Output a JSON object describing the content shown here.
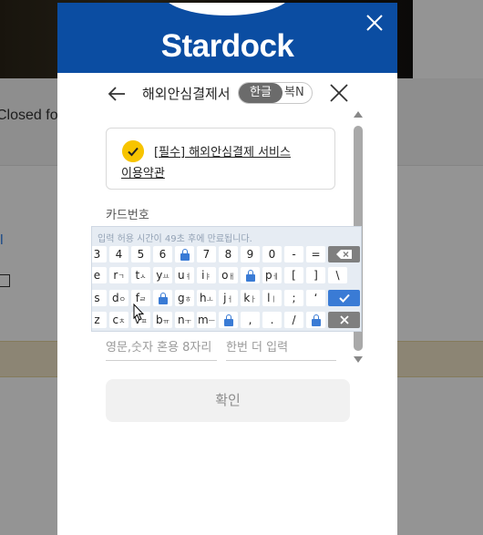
{
  "background": {
    "closed_text": "Closed fo",
    "link_text": "ll"
  },
  "modal": {
    "brand": "Stardock",
    "close_icon": "close-icon"
  },
  "panel": {
    "title": "해외안심결제서",
    "lang_active": "한글",
    "lang_other": "N",
    "title_tail": "복",
    "terms_line1": "[필수] 해외안심결제 서비스",
    "terms_line2": "이용약관",
    "card_label": "카드번호",
    "pw_placeholder": "영문,숫자 혼용 8자리",
    "pw_confirm_placeholder": "한번 더 입력",
    "confirm_label": "확인"
  },
  "keypad": {
    "notice": "입력 허용 시간이 49초 후에 만료됩니다.",
    "row1": [
      "3",
      "4",
      "5",
      "6",
      "lock",
      "7",
      "8",
      "9",
      "0",
      "-",
      "=",
      "backspace"
    ],
    "row2": [
      "e",
      "r ㄱ",
      "t ㅅ",
      "y ㅛ",
      "u ㅕ",
      "i ㅑ",
      "o ㅐ",
      "lock",
      "p ㅔ",
      "[",
      "]",
      "\\"
    ],
    "row3": [
      "s",
      "d ㅇ",
      "f ㄹ",
      "lock",
      "g ㅎ",
      "h ㅗ",
      "j ㅓ",
      "k ㅏ",
      "l ㅣ",
      ";",
      "‘",
      "enter"
    ],
    "row4": [
      "z",
      "c ㅊ",
      "v ㅍ",
      "b ㅠ",
      "n ㅜ",
      "m ㅡ",
      "lock",
      ",",
      ".",
      "/",
      "lock",
      "clear"
    ]
  },
  "colors": {
    "brand_blue": "#0b4da2",
    "check_yellow": "#f7c400",
    "key_blue": "#3a7bd5"
  }
}
